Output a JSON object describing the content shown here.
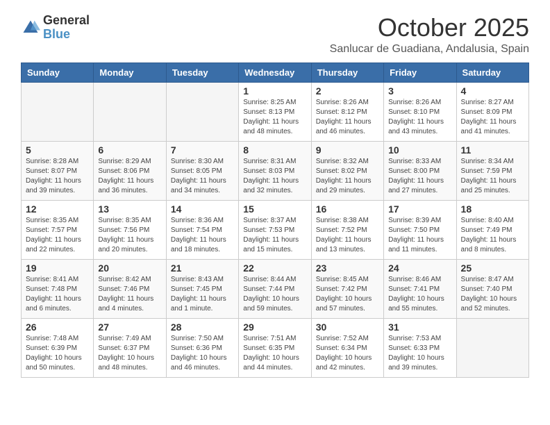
{
  "header": {
    "logo_general": "General",
    "logo_blue": "Blue",
    "month_title": "October 2025",
    "location": "Sanlucar de Guadiana, Andalusia, Spain"
  },
  "weekdays": [
    "Sunday",
    "Monday",
    "Tuesday",
    "Wednesday",
    "Thursday",
    "Friday",
    "Saturday"
  ],
  "weeks": [
    [
      {
        "day": "",
        "sunrise": "",
        "sunset": "",
        "daylight": ""
      },
      {
        "day": "",
        "sunrise": "",
        "sunset": "",
        "daylight": ""
      },
      {
        "day": "",
        "sunrise": "",
        "sunset": "",
        "daylight": ""
      },
      {
        "day": "1",
        "sunrise": "Sunrise: 8:25 AM",
        "sunset": "Sunset: 8:13 PM",
        "daylight": "Daylight: 11 hours and 48 minutes."
      },
      {
        "day": "2",
        "sunrise": "Sunrise: 8:26 AM",
        "sunset": "Sunset: 8:12 PM",
        "daylight": "Daylight: 11 hours and 46 minutes."
      },
      {
        "day": "3",
        "sunrise": "Sunrise: 8:26 AM",
        "sunset": "Sunset: 8:10 PM",
        "daylight": "Daylight: 11 hours and 43 minutes."
      },
      {
        "day": "4",
        "sunrise": "Sunrise: 8:27 AM",
        "sunset": "Sunset: 8:09 PM",
        "daylight": "Daylight: 11 hours and 41 minutes."
      }
    ],
    [
      {
        "day": "5",
        "sunrise": "Sunrise: 8:28 AM",
        "sunset": "Sunset: 8:07 PM",
        "daylight": "Daylight: 11 hours and 39 minutes."
      },
      {
        "day": "6",
        "sunrise": "Sunrise: 8:29 AM",
        "sunset": "Sunset: 8:06 PM",
        "daylight": "Daylight: 11 hours and 36 minutes."
      },
      {
        "day": "7",
        "sunrise": "Sunrise: 8:30 AM",
        "sunset": "Sunset: 8:05 PM",
        "daylight": "Daylight: 11 hours and 34 minutes."
      },
      {
        "day": "8",
        "sunrise": "Sunrise: 8:31 AM",
        "sunset": "Sunset: 8:03 PM",
        "daylight": "Daylight: 11 hours and 32 minutes."
      },
      {
        "day": "9",
        "sunrise": "Sunrise: 8:32 AM",
        "sunset": "Sunset: 8:02 PM",
        "daylight": "Daylight: 11 hours and 29 minutes."
      },
      {
        "day": "10",
        "sunrise": "Sunrise: 8:33 AM",
        "sunset": "Sunset: 8:00 PM",
        "daylight": "Daylight: 11 hours and 27 minutes."
      },
      {
        "day": "11",
        "sunrise": "Sunrise: 8:34 AM",
        "sunset": "Sunset: 7:59 PM",
        "daylight": "Daylight: 11 hours and 25 minutes."
      }
    ],
    [
      {
        "day": "12",
        "sunrise": "Sunrise: 8:35 AM",
        "sunset": "Sunset: 7:57 PM",
        "daylight": "Daylight: 11 hours and 22 minutes."
      },
      {
        "day": "13",
        "sunrise": "Sunrise: 8:35 AM",
        "sunset": "Sunset: 7:56 PM",
        "daylight": "Daylight: 11 hours and 20 minutes."
      },
      {
        "day": "14",
        "sunrise": "Sunrise: 8:36 AM",
        "sunset": "Sunset: 7:54 PM",
        "daylight": "Daylight: 11 hours and 18 minutes."
      },
      {
        "day": "15",
        "sunrise": "Sunrise: 8:37 AM",
        "sunset": "Sunset: 7:53 PM",
        "daylight": "Daylight: 11 hours and 15 minutes."
      },
      {
        "day": "16",
        "sunrise": "Sunrise: 8:38 AM",
        "sunset": "Sunset: 7:52 PM",
        "daylight": "Daylight: 11 hours and 13 minutes."
      },
      {
        "day": "17",
        "sunrise": "Sunrise: 8:39 AM",
        "sunset": "Sunset: 7:50 PM",
        "daylight": "Daylight: 11 hours and 11 minutes."
      },
      {
        "day": "18",
        "sunrise": "Sunrise: 8:40 AM",
        "sunset": "Sunset: 7:49 PM",
        "daylight": "Daylight: 11 hours and 8 minutes."
      }
    ],
    [
      {
        "day": "19",
        "sunrise": "Sunrise: 8:41 AM",
        "sunset": "Sunset: 7:48 PM",
        "daylight": "Daylight: 11 hours and 6 minutes."
      },
      {
        "day": "20",
        "sunrise": "Sunrise: 8:42 AM",
        "sunset": "Sunset: 7:46 PM",
        "daylight": "Daylight: 11 hours and 4 minutes."
      },
      {
        "day": "21",
        "sunrise": "Sunrise: 8:43 AM",
        "sunset": "Sunset: 7:45 PM",
        "daylight": "Daylight: 11 hours and 1 minute."
      },
      {
        "day": "22",
        "sunrise": "Sunrise: 8:44 AM",
        "sunset": "Sunset: 7:44 PM",
        "daylight": "Daylight: 10 hours and 59 minutes."
      },
      {
        "day": "23",
        "sunrise": "Sunrise: 8:45 AM",
        "sunset": "Sunset: 7:42 PM",
        "daylight": "Daylight: 10 hours and 57 minutes."
      },
      {
        "day": "24",
        "sunrise": "Sunrise: 8:46 AM",
        "sunset": "Sunset: 7:41 PM",
        "daylight": "Daylight: 10 hours and 55 minutes."
      },
      {
        "day": "25",
        "sunrise": "Sunrise: 8:47 AM",
        "sunset": "Sunset: 7:40 PM",
        "daylight": "Daylight: 10 hours and 52 minutes."
      }
    ],
    [
      {
        "day": "26",
        "sunrise": "Sunrise: 7:48 AM",
        "sunset": "Sunset: 6:39 PM",
        "daylight": "Daylight: 10 hours and 50 minutes."
      },
      {
        "day": "27",
        "sunrise": "Sunrise: 7:49 AM",
        "sunset": "Sunset: 6:37 PM",
        "daylight": "Daylight: 10 hours and 48 minutes."
      },
      {
        "day": "28",
        "sunrise": "Sunrise: 7:50 AM",
        "sunset": "Sunset: 6:36 PM",
        "daylight": "Daylight: 10 hours and 46 minutes."
      },
      {
        "day": "29",
        "sunrise": "Sunrise: 7:51 AM",
        "sunset": "Sunset: 6:35 PM",
        "daylight": "Daylight: 10 hours and 44 minutes."
      },
      {
        "day": "30",
        "sunrise": "Sunrise: 7:52 AM",
        "sunset": "Sunset: 6:34 PM",
        "daylight": "Daylight: 10 hours and 42 minutes."
      },
      {
        "day": "31",
        "sunrise": "Sunrise: 7:53 AM",
        "sunset": "Sunset: 6:33 PM",
        "daylight": "Daylight: 10 hours and 39 minutes."
      },
      {
        "day": "",
        "sunrise": "",
        "sunset": "",
        "daylight": ""
      }
    ]
  ]
}
